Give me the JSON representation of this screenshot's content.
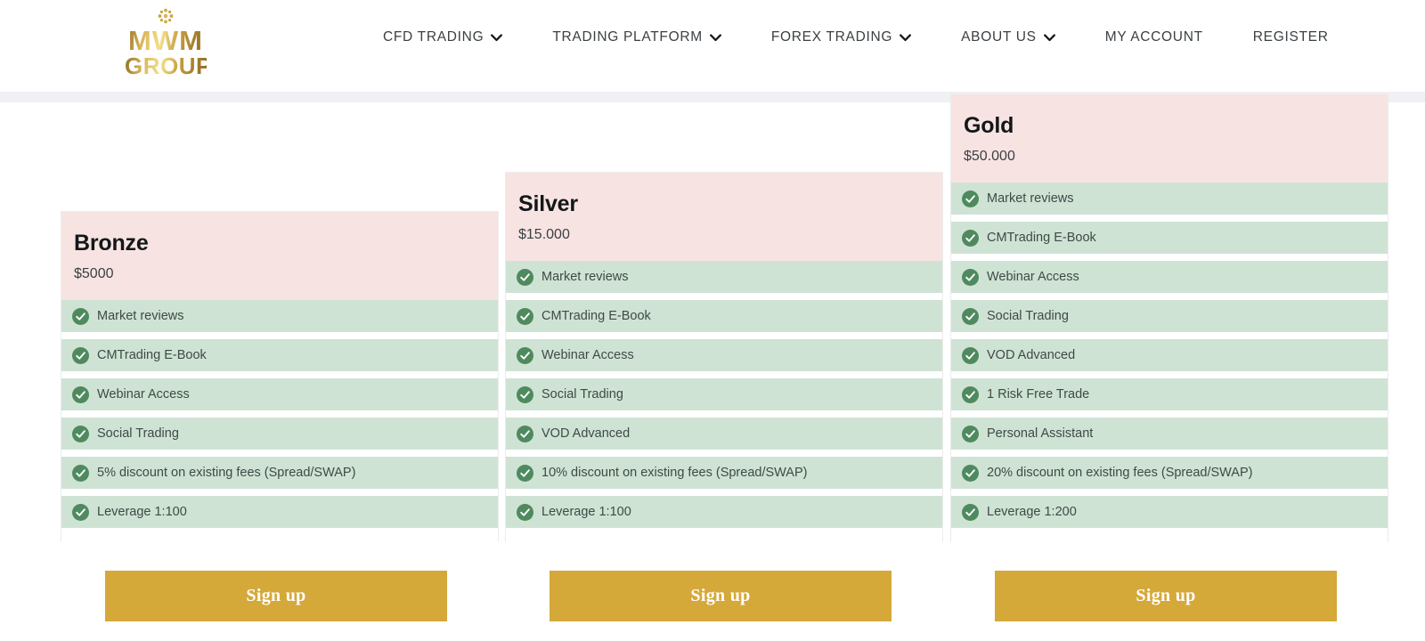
{
  "header": {
    "logo": {
      "ornament_icon": "rosette-ornament-icon",
      "line1": "MWM",
      "line2": "GROUP"
    },
    "nav": [
      {
        "label": "CFD TRADING",
        "has_dropdown": true
      },
      {
        "label": "TRADING PLATFORM",
        "has_dropdown": true
      },
      {
        "label": "FOREX TRADING",
        "has_dropdown": true
      },
      {
        "label": "ABOUT US",
        "has_dropdown": true
      },
      {
        "label": "MY ACCOUNT",
        "has_dropdown": false
      },
      {
        "label": "REGISTER",
        "has_dropdown": false
      }
    ]
  },
  "colors": {
    "plan_header_bg": "#f7e4e2",
    "feature_row_bg": "#cfe3d5",
    "check_circle": "#4f8a5f",
    "signup_button": "#d5a83a",
    "header_band": "#f0f1f5",
    "logo_gold": "#c49b3e"
  },
  "plans": [
    {
      "name": "Bronze",
      "price": "$5000",
      "features": [
        "Market reviews",
        "CMTrading E-Book",
        "Webinar Access",
        "Social Trading",
        "5% discount on existing fees (Spread/SWAP)",
        "Leverage 1:100"
      ],
      "cta": "Sign up"
    },
    {
      "name": "Silver",
      "price": "$15.000",
      "features": [
        "Market reviews",
        "CMTrading E-Book",
        "Webinar Access",
        "Social Trading",
        "VOD Advanced",
        "10% discount on existing fees (Spread/SWAP)",
        "Leverage 1:100"
      ],
      "cta": "Sign up"
    },
    {
      "name": "Gold",
      "price": "$50.000",
      "features": [
        "Market reviews",
        "CMTrading E-Book",
        "Webinar Access",
        "Social Trading",
        "VOD Advanced",
        "1 Risk Free Trade",
        "Personal Assistant",
        "20% discount on existing fees (Spread/SWAP)",
        "Leverage 1:200"
      ],
      "cta": "Sign up"
    }
  ]
}
